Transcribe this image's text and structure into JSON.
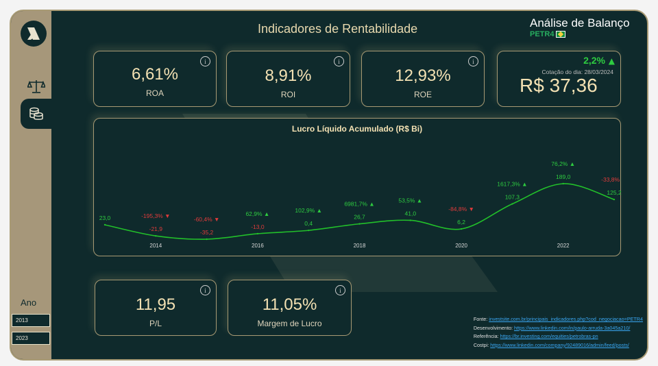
{
  "header": {
    "title": "Indicadores de Rentabilidade",
    "brand_title": "Análise de Balanço",
    "ticker": "PETR4"
  },
  "sidebar": {
    "logo_icon": "brand-logo-icon",
    "nav": [
      {
        "icon": "balance-scale-icon"
      },
      {
        "icon": "coins-icon"
      }
    ],
    "year_label": "Ano",
    "year_start": "2013",
    "year_end": "2023"
  },
  "kpis": {
    "roa": {
      "value": "6,61%",
      "label": "ROA"
    },
    "roi": {
      "value": "8,91%",
      "label": "ROI"
    },
    "roe": {
      "value": "12,93%",
      "label": "ROE"
    },
    "pl": {
      "value": "11,95",
      "label": "P/L"
    },
    "margem": {
      "value": "11,05%",
      "label": "Margem de Lucro"
    }
  },
  "price": {
    "change": "2,2%",
    "date_label": "Cotação do dia: 28/03/2024",
    "value": "R$ 37,36"
  },
  "chart_data": {
    "type": "line",
    "title": "Lucro Líquido Acumulado (R$ Bi)",
    "x": [
      2013,
      2014,
      2015,
      2016,
      2017,
      2018,
      2019,
      2020,
      2021,
      2022,
      2023
    ],
    "values": [
      23.0,
      -21.9,
      -35.2,
      -13.0,
      0.4,
      26.7,
      41.0,
      6.2,
      107.3,
      189.0,
      125.2
    ],
    "value_labels": [
      "23,0",
      "-21,9",
      "-35,2",
      "-13,0",
      "0,4",
      "26,7",
      "41,0",
      "6,2",
      "107,3",
      "189,0",
      "125,2"
    ],
    "pct_change": [
      "",
      "-195,3%",
      "-60,4%",
      "62,9%",
      "102,9%",
      "6981,7%",
      "53,5%",
      "-84,8%",
      "1617,3%",
      "76,2%",
      "-33,8%"
    ],
    "pct_direction": [
      "",
      "down",
      "down",
      "up",
      "up",
      "up",
      "up",
      "down",
      "up",
      "up",
      "down"
    ],
    "x_tick_labels": [
      "2014",
      "2016",
      "2018",
      "2020",
      "2022"
    ],
    "colors": {
      "line": "#22c02a",
      "up": "#2ecc40",
      "down": "#e03b3b"
    }
  },
  "sources": [
    {
      "label": "Fonte:",
      "link": "investsite.com.br/principais_indicadores.php?cod_negociacao=PETR4"
    },
    {
      "label": "Desenvolvimento:",
      "link": "https://www.linkedin.com/in/paulo-arruda-3a045a210/"
    },
    {
      "label": "Referência:",
      "link": "https://br.investing.com/equities/petrobras-pn"
    },
    {
      "label": "Costpi:",
      "link": "https://www.linkedin.com/company/92489016/admin/feed/posts/"
    }
  ]
}
